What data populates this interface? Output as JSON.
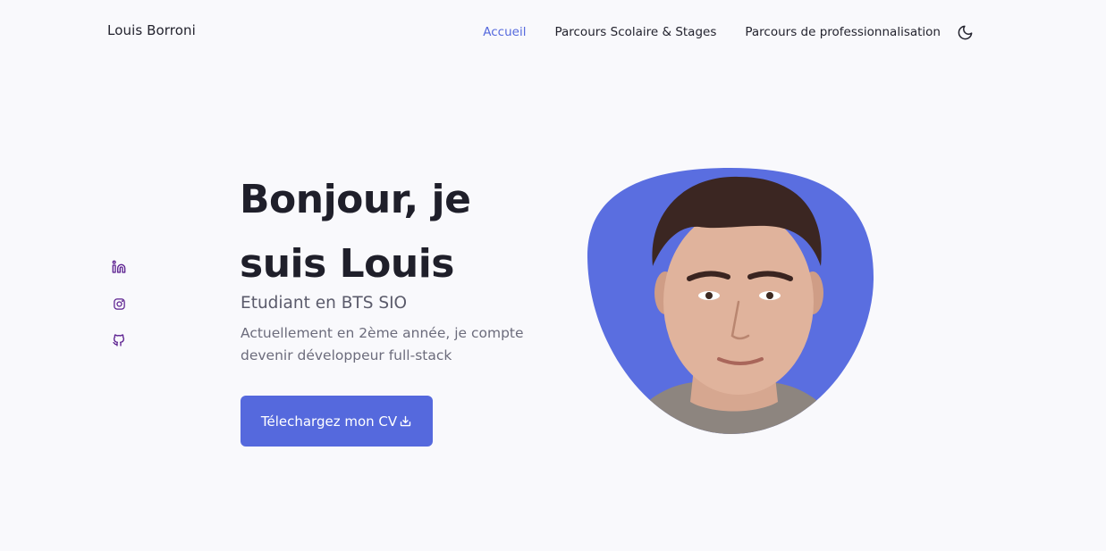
{
  "header": {
    "logo": "Louis Borroni",
    "nav": [
      {
        "label": "Accueil",
        "active": true
      },
      {
        "label": "Parcours Scolaire & Stages",
        "active": false
      },
      {
        "label": "Parcours de professionnalisation",
        "active": false
      }
    ],
    "theme_toggle_icon": "moon-icon"
  },
  "social": [
    {
      "icon": "linkedin-icon"
    },
    {
      "icon": "instagram-icon"
    },
    {
      "icon": "github-icon"
    }
  ],
  "hero": {
    "title": "Bonjour, je suis Louis",
    "subtitle": "Etudiant en BTS SIO",
    "description": "Actuellement en 2ème année, je compte devenir développeur full-stack",
    "cta_label": "Télechargez mon CV",
    "cta_icon": "download-icon"
  },
  "colors": {
    "accent": "#5569dd",
    "background": "#f9f9fc",
    "title": "#1f1f2a",
    "text": "#6c6c7c",
    "social_icon": "#5b1f8f"
  }
}
